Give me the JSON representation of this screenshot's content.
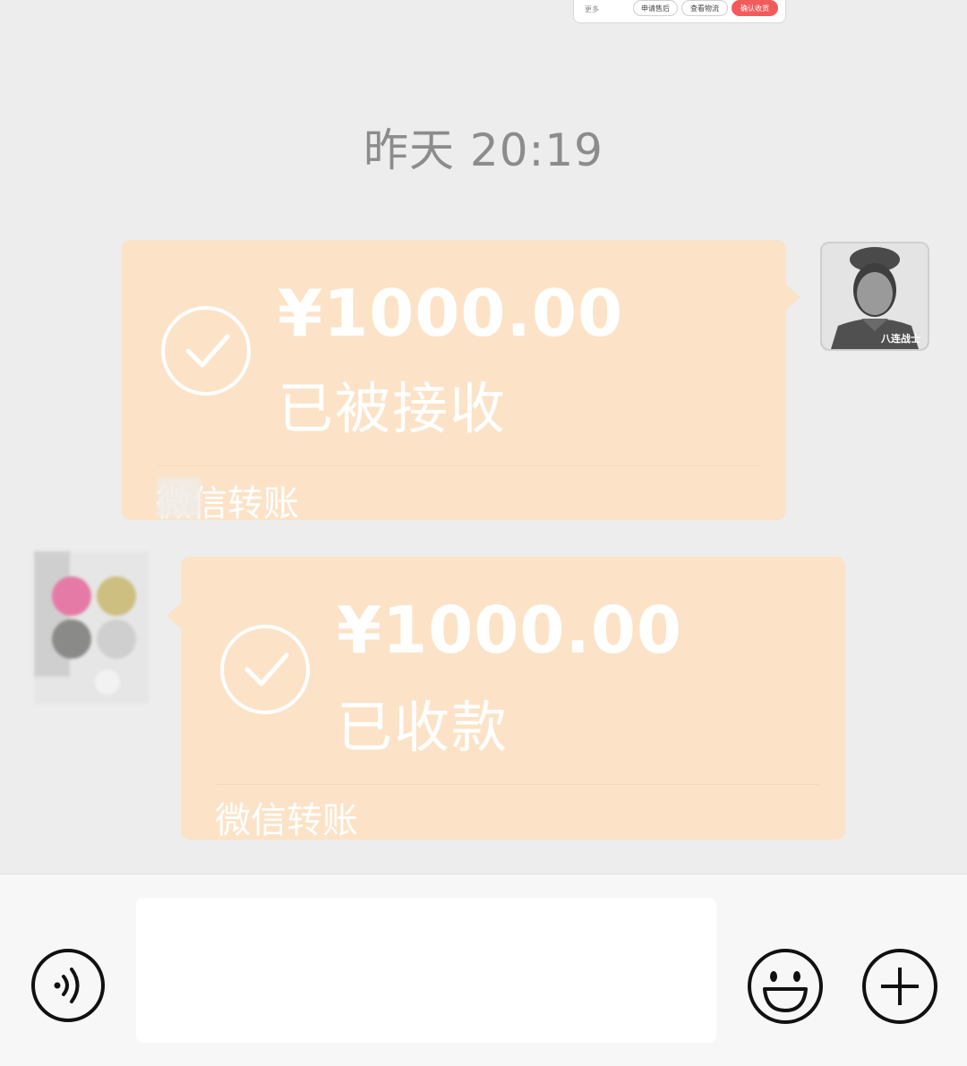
{
  "order_card": {
    "more_label": "更多",
    "buttons": [
      "申请售后",
      "查看物流",
      "确认收货"
    ]
  },
  "timestamp": "昨天 20:19",
  "messages": [
    {
      "side": "right",
      "amount": "¥1000.00",
      "status": "已被接收",
      "footer": "微信转账",
      "icon": "check-circle-icon",
      "avatar_caption": "八连战士"
    },
    {
      "side": "left",
      "amount": "¥1000.00",
      "status": "已收款",
      "footer": "微信转账",
      "icon": "check-circle-icon"
    }
  ],
  "input_bar": {
    "voice_icon": "voice-icon",
    "emoji_icon": "emoji-icon",
    "plus_icon": "plus-icon",
    "input_value": ""
  },
  "colors": {
    "background": "#ededed",
    "bubble": "#fce3c7",
    "accent_red": "#f25b5b",
    "timestamp": "#8c8c8c"
  }
}
